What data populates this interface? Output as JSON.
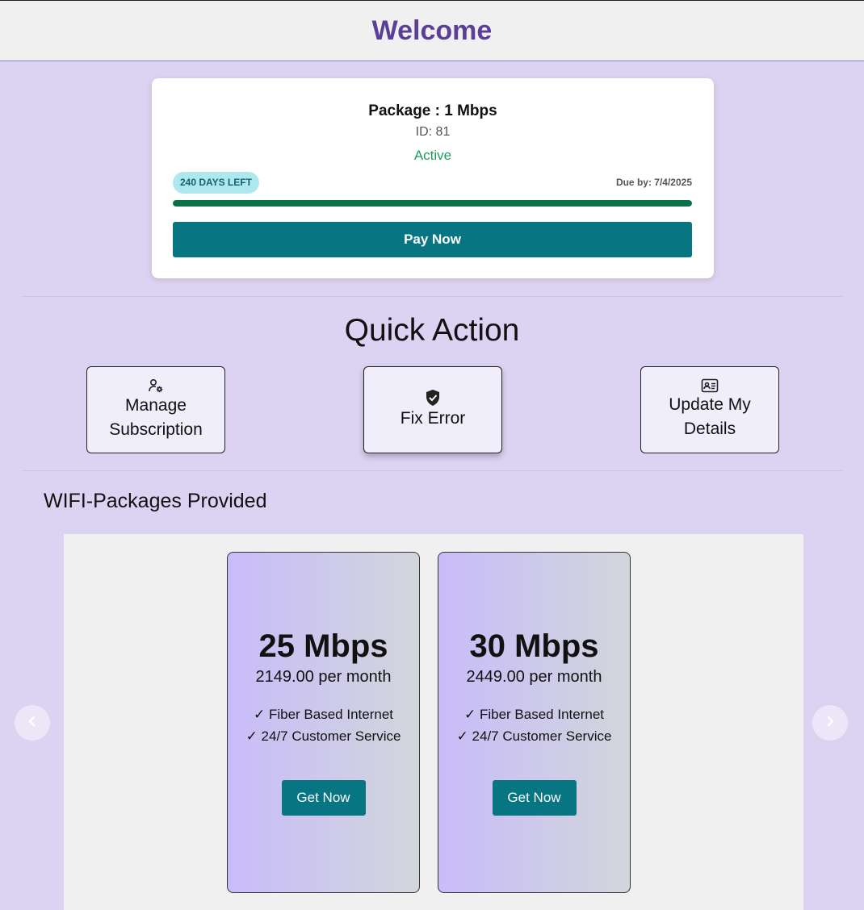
{
  "header": {
    "title": "Welcome"
  },
  "package_card": {
    "title": "Package : 1 Mbps",
    "id_text": "ID: 81",
    "status": "Active",
    "days_left": "240 DAYS LEFT",
    "due": "Due by: 7/4/2025",
    "progress_fraction": 1.0,
    "pay_label": "Pay Now"
  },
  "quick_action": {
    "title": "Quick Action",
    "buttons": [
      {
        "label_line1": "Manage",
        "label_line2": "Subscription",
        "icon": "user-gear-icon"
      },
      {
        "label": "Fix Error",
        "icon": "shield-check-icon"
      },
      {
        "label_line1": "Update My",
        "label_line2": "Details",
        "icon": "id-card-icon"
      }
    ]
  },
  "packages": {
    "title": "WIFI-Packages Provided",
    "plans": [
      {
        "speed": "25 Mbps",
        "price": "2149.00 per month",
        "feature1": "✓ Fiber Based Internet",
        "feature2": "✓ 24/7 Customer Service",
        "cta": "Get Now"
      },
      {
        "speed": "30 Mbps",
        "price": "2449.00 per month",
        "feature1": "✓ Fiber Based Internet",
        "feature2": "✓ 24/7 Customer Service",
        "cta": "Get Now"
      }
    ]
  },
  "colors": {
    "background": "#dcd3f2",
    "accent": "#077582",
    "title_purple": "#5b3f96",
    "status_green": "#1f9d5f",
    "progress_green": "#0a7047"
  }
}
